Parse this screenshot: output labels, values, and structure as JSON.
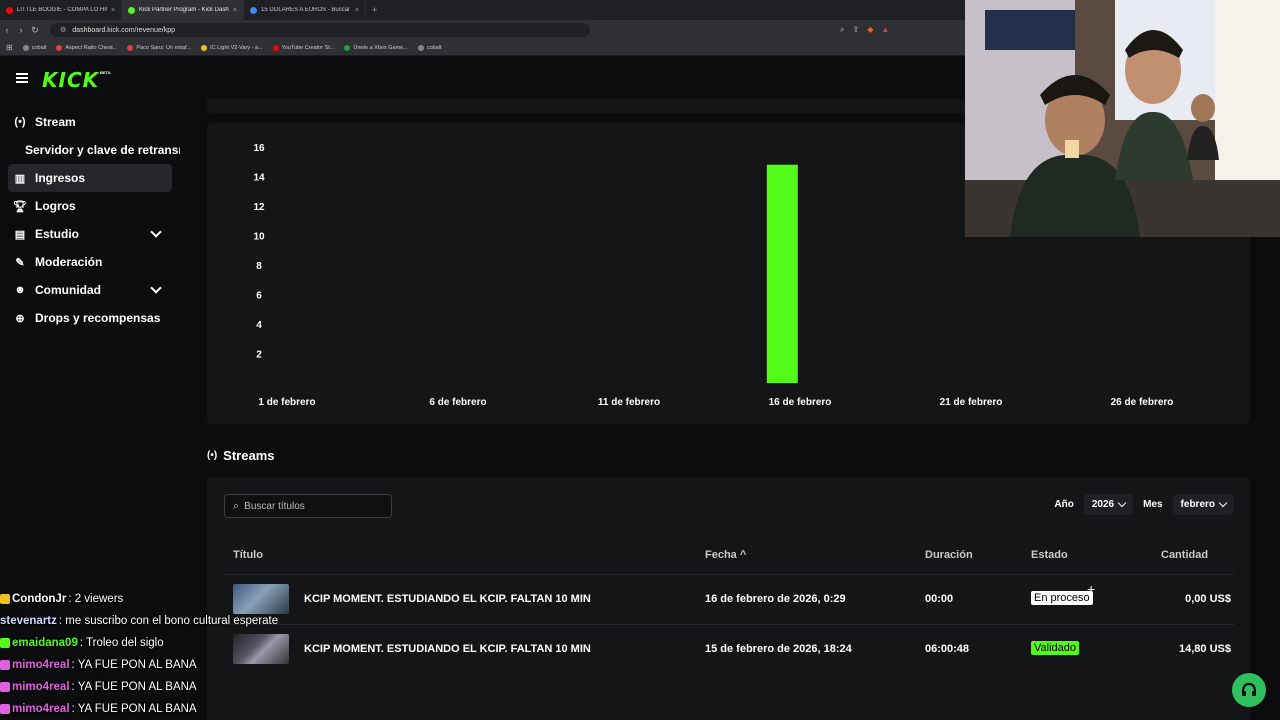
{
  "browser": {
    "tabs": [
      {
        "label": "LITTLE BOOGIE - COMPA LO HICIMOS",
        "color": "#ff0000",
        "active": false
      },
      {
        "label": "Kick Partner Program - Kick Dashboard",
        "color": "#53fc18",
        "active": true
      },
      {
        "label": "15 DOLARES A EUROS - Buscar con Google",
        "color": "#4285f4",
        "active": false
      }
    ],
    "url": "dashboard.kick.com/revenue/kpp",
    "bookmarks": [
      {
        "label": "cobalt",
        "color": "#888888"
      },
      {
        "label": "Aspect Ratio Cheat...",
        "color": "#e04040"
      },
      {
        "label": "Paco Sanz: Un estaf...",
        "color": "#e04040"
      },
      {
        "label": "IC Light V2-Vary - a...",
        "color": "#f0c020"
      },
      {
        "label": "YouTube Creator St...",
        "color": "#ff0000"
      },
      {
        "label": "Únete a Xbox Game...",
        "color": "#20a040"
      },
      {
        "label": "cobalt",
        "color": "#888888"
      }
    ]
  },
  "header": {
    "logo": "KICK",
    "beta": "BETA"
  },
  "sidebar": {
    "items": [
      {
        "label": "Stream",
        "icon": "broadcast-icon"
      },
      {
        "label": "Servidor y clave de retransmisión",
        "icon": ""
      },
      {
        "label": "Ingresos",
        "icon": "chart-icon"
      },
      {
        "label": "Logros",
        "icon": "trophy-icon"
      },
      {
        "label": "Estudio",
        "icon": "film-icon"
      },
      {
        "label": "Moderación",
        "icon": "wrench-icon"
      },
      {
        "label": "Comunidad",
        "icon": "people-icon"
      },
      {
        "label": "Drops y recompensas",
        "icon": "gift-icon"
      }
    ]
  },
  "chart_data": {
    "type": "bar",
    "x_tick_labels": [
      "1 de febrero",
      "6 de febrero",
      "11 de febrero",
      "16 de febrero",
      "21 de febrero",
      "26 de febrero"
    ],
    "y_ticks": [
      2,
      4,
      6,
      8,
      10,
      12,
      14,
      16
    ],
    "ylim": [
      0,
      16
    ],
    "x_range": [
      1,
      28
    ],
    "series": [
      {
        "x": [
          15
        ],
        "values": [
          14.8
        ]
      }
    ],
    "bar_color": "#53fc18",
    "grid": false
  },
  "streams": {
    "title": "Streams",
    "search_placeholder": "Buscar títulos",
    "year_label": "Año",
    "year_value": "2026",
    "month_label": "Mes",
    "month_value": "febrero",
    "columns": {
      "title": "Título",
      "date": "Fecha ^",
      "duration": "Duración",
      "status": "Estado",
      "amount": "Cantidad"
    },
    "rows": [
      {
        "title": "KCIP MOMENT. ESTUDIANDO EL KCIP. FALTAN 10 MIN",
        "date": "16 de febrero de 2026, 0:29",
        "duration": "00:00",
        "status": "En proceso",
        "amount": "0,00 US$"
      },
      {
        "title": "KCIP MOMENT. ESTUDIANDO EL KCIP. FALTAN 10 MIN",
        "date": "15 de febrero de 2026, 18:24",
        "duration": "06:00:48",
        "status": "Validado",
        "amount": "14,80 US$"
      }
    ]
  },
  "chat": [
    {
      "user": "CondonJr",
      "user_color": "#ffffff",
      "message": ": 2 viewers"
    },
    {
      "user": "stevenartz",
      "user_color": "#cfd8ff",
      "message": ": me suscribo con el bono cultural esperate"
    },
    {
      "user": "emaidana09",
      "user_color": "#53fc18",
      "message": ": Troleo del siglo"
    },
    {
      "user": "mimo4real",
      "user_color": "#e060e0",
      "message": ": YA FUE PON AL BANA"
    },
    {
      "user": "mimo4real",
      "user_color": "#e060e0",
      "message": ": YA FUE PON AL BANA"
    },
    {
      "user": "mimo4real",
      "user_color": "#e060e0",
      "message": ": YA FUE PON AL BANA"
    }
  ]
}
